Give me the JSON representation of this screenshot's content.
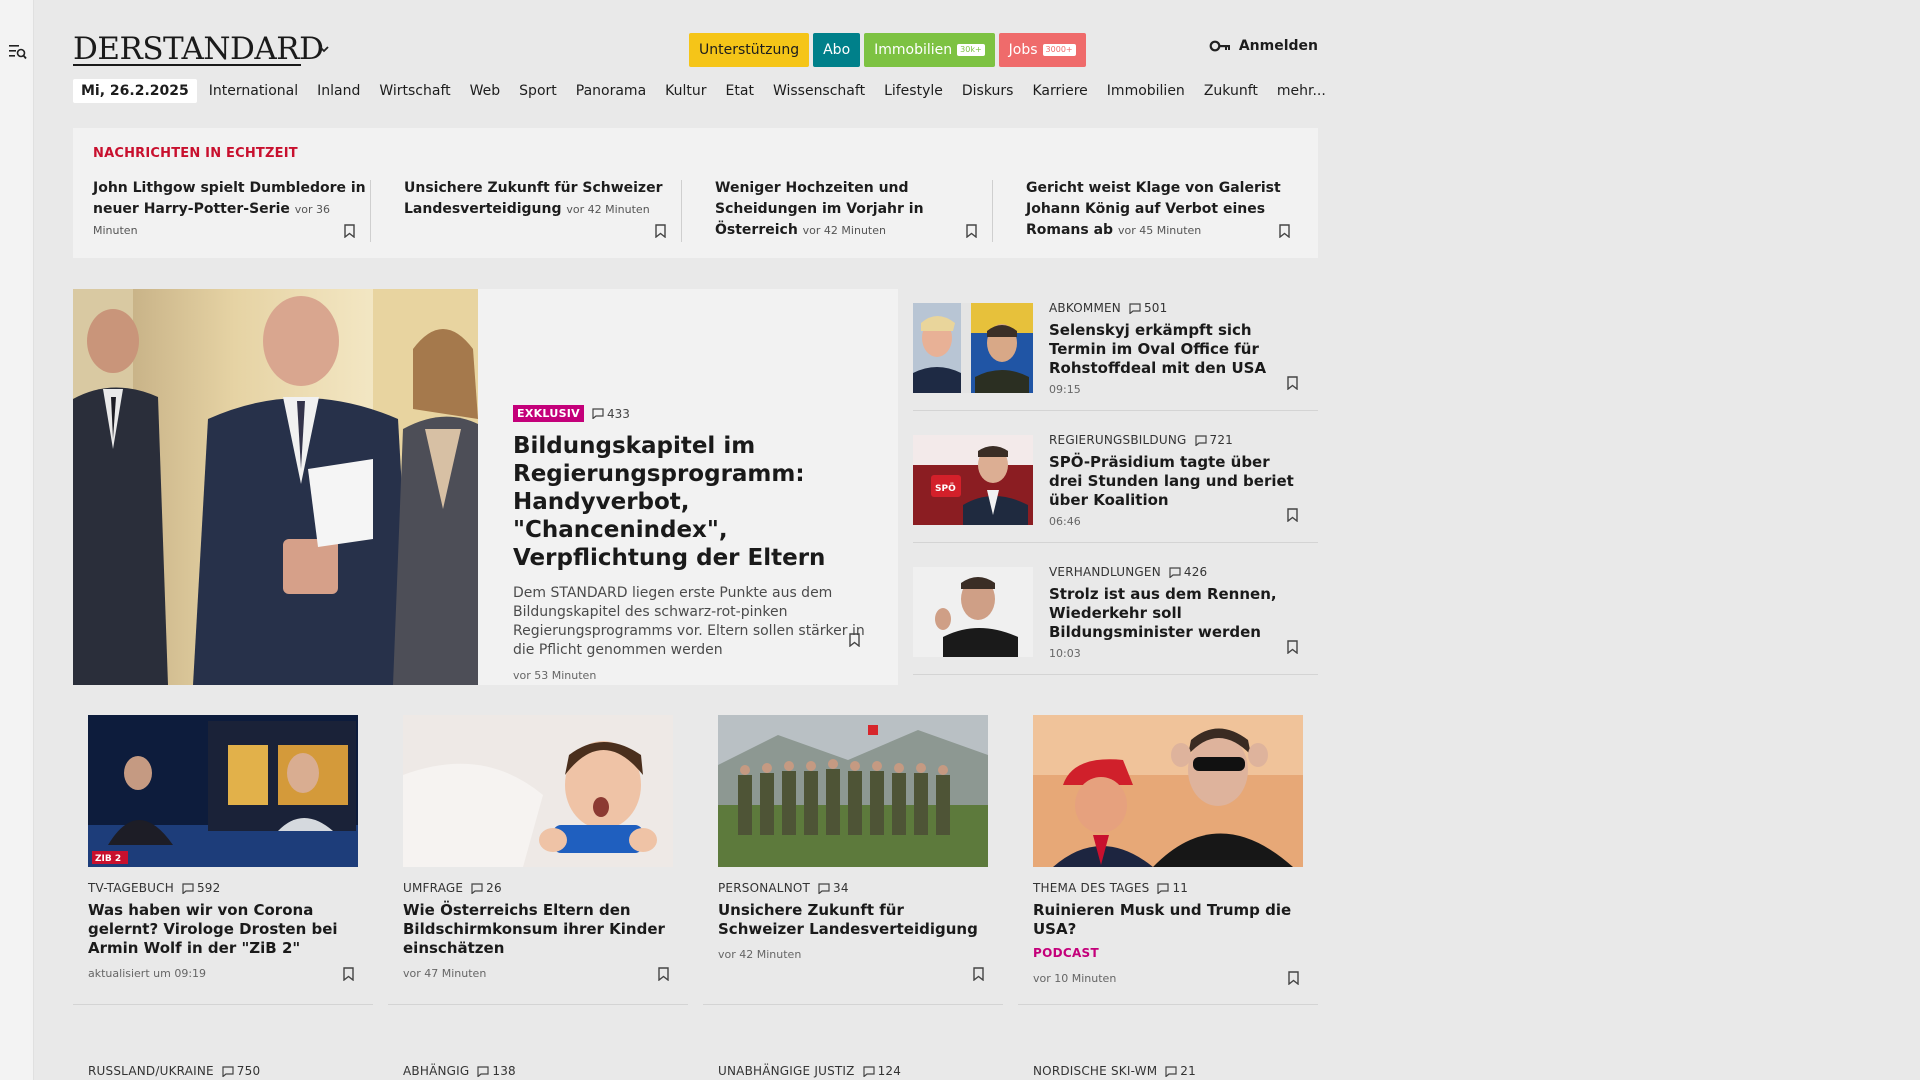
{
  "brand": {
    "name": "DERSTANDARD"
  },
  "header": {
    "pills": [
      {
        "label": "Unterstützung",
        "bg": "#f5c518",
        "fg": "#1d1d1d",
        "badge": ""
      },
      {
        "label": "Abo",
        "bg": "#00808a",
        "fg": "#ffffff",
        "badge": ""
      },
      {
        "label": "Immobilien",
        "bg": "#7dc242",
        "fg": "#ffffff",
        "badge": "30k+"
      },
      {
        "label": "Jobs",
        "bg": "#ef6b6b",
        "fg": "#ffffff",
        "badge": "3000+"
      }
    ],
    "login_label": "Anmelden"
  },
  "nav": {
    "date": "Mi, 26.2.2025",
    "items": [
      "International",
      "Inland",
      "Wirtschaft",
      "Web",
      "Sport",
      "Panorama",
      "Kultur",
      "Etat",
      "Wissenschaft",
      "Lifestyle",
      "Diskurs",
      "Karriere",
      "Immobilien",
      "Zukunft",
      "mehr..."
    ]
  },
  "ticker": {
    "heading": "NACHRICHTEN IN ECHTZEIT",
    "items": [
      {
        "title": "John Lithgow spielt Dumbledore in neuer Harry-Potter-Serie",
        "time": "vor 36 Minuten"
      },
      {
        "title": "Unsichere Zukunft für Schweizer Landesverteidigung",
        "time": "vor 42 Minuten"
      },
      {
        "title": "Weniger Hochzeiten und Scheidungen im Vorjahr in Österreich",
        "time": "vor 42 Minuten"
      },
      {
        "title": "Gericht weist Klage von Galerist Johann König auf Verbot eines Romans ab",
        "time": "vor 45 Minuten"
      }
    ]
  },
  "hero": {
    "label": "EXKLUSIV",
    "comments": "433",
    "title": "Bildungskapitel im Regierungsprogramm: Handyverbot, \"Chancenindex\", Verpflichtung der Eltern",
    "teaser": "Dem STANDARD liegen erste Punkte aus dem Bildungskapitel des schwarz-rot-pinken Regierungsprogramms vor. Eltern sollen stärker in die Pflicht genommen werden",
    "time": "vor 53 Minuten"
  },
  "side": [
    {
      "kicker": "ABKOMMEN",
      "comments": "501",
      "title": "Selenskyj erkämpft sich Termin im Oval Office für Rohstoffdeal mit den USA",
      "time": "09:15"
    },
    {
      "kicker": "REGIERUNGSBILDUNG",
      "comments": "721",
      "title": "SPÖ-Präsidium tagte über drei Stunden lang und beriet über Koalition",
      "time": "06:46"
    },
    {
      "kicker": "VERHANDLUNGEN",
      "comments": "426",
      "title": "Strolz ist aus dem Rennen, Wiederkehr soll Bildungsminister werden",
      "time": "10:03"
    }
  ],
  "cards": [
    {
      "kicker": "TV-TAGEBUCH",
      "comments": "592",
      "title": "Was haben wir von Corona gelernt? Virologe Drosten bei Armin Wolf in der \"ZiB 2\"",
      "extra": "",
      "time": "aktualisiert um 09:19"
    },
    {
      "kicker": "UMFRAGE",
      "comments": "26",
      "title": "Wie Österreichs Eltern den Bildschirmkonsum ihrer Kinder einschätzen",
      "extra": "",
      "time": "vor 47 Minuten"
    },
    {
      "kicker": "PERSONALNOT",
      "comments": "34",
      "title": "Unsichere Zukunft für Schweizer Landesverteidigung",
      "extra": "",
      "time": "vor 42 Minuten"
    },
    {
      "kicker": "THEMA DES TAGES",
      "comments": "11",
      "title": "Ruinieren Musk und Trump die USA?",
      "extra": "PODCAST",
      "time": "vor 10 Minuten"
    }
  ],
  "lower": [
    {
      "kicker": "RUSSLAND/UKRAINE",
      "comments": "750"
    },
    {
      "kicker": "ABHÄNGIG",
      "comments": "138"
    },
    {
      "kicker": "UNABHÄNGIGE JUSTIZ",
      "comments": "124"
    },
    {
      "kicker": "NORDISCHE SKI-WM",
      "comments": "21"
    }
  ],
  "image_text": {
    "zib": "ZIB 2",
    "spoe": "SPÖ"
  }
}
